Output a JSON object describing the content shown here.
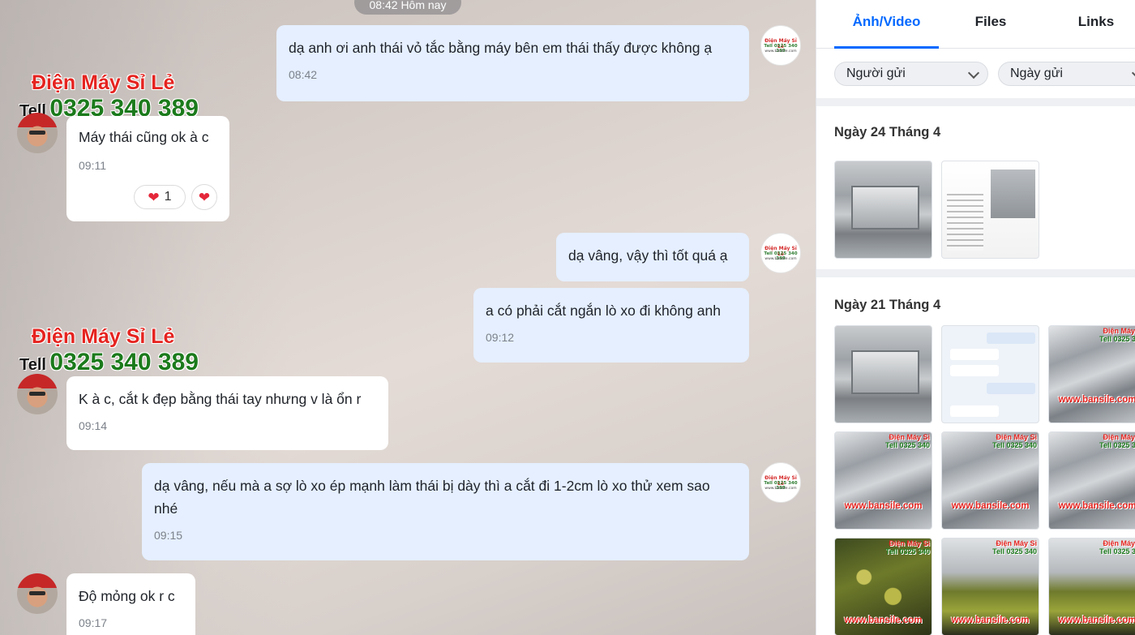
{
  "chat": {
    "time_divider": "08:42 Hôm nay",
    "watermark": {
      "brand": "Điện Máy Sỉ Lẻ",
      "tell": "Tell",
      "phone": "0325 340 389"
    },
    "shop_avatar": {
      "line1": "Điện Máy Sỉ Lẻ",
      "line2": "Tell 0325 340 389",
      "line3": "www.bansile.com"
    },
    "messages": [
      {
        "text": "dạ anh ơi anh thái vỏ tắc bằng máy bên em thái thấy được không ạ",
        "time": "08:42"
      },
      {
        "text": "Máy thái cũng ok à c",
        "time": "09:11",
        "reaction_count": "1"
      },
      {
        "text": "dạ vâng, vậy thì tốt quá ạ",
        "time": ""
      },
      {
        "text": "a có phải cắt ngắn lò xo đi không anh",
        "time": "09:12"
      },
      {
        "text": "K à c, cắt k đẹp bằng thái tay nhưng v là ổn r",
        "time": "09:14"
      },
      {
        "text": "dạ vâng, nếu mà a sợ lò xo ép mạnh làm thái bị dày thì a cắt đi 1-2cm lò xo thử xem sao nhé",
        "time": "09:15"
      },
      {
        "text": "Độ mỏng ok r c",
        "time": "09:17"
      }
    ]
  },
  "panel": {
    "tabs": [
      "Ảnh/Video",
      "Files",
      "Links"
    ],
    "filters": {
      "sender": "Người gửi",
      "date": "Ngày gửi"
    },
    "sections": [
      {
        "title": "Ngày 24 Tháng 4"
      },
      {
        "title": "Ngày 21 Tháng 4"
      }
    ],
    "thumb_watermark": {
      "brand": "Điện Máy Sỉ",
      "phone": "Tell 0325 340",
      "site": "www.bansile.com"
    }
  },
  "colors": {
    "accent": "#0068ff",
    "outgoing_bubble": "#e5efff",
    "incoming_bubble": "#ffffff",
    "brand_red": "#e5231f",
    "brand_green": "#1b7a1b"
  }
}
